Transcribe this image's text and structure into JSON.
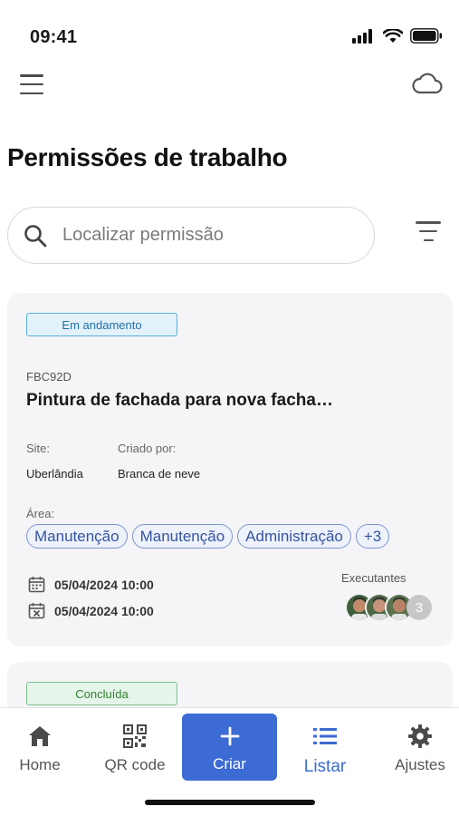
{
  "status_bar": {
    "time": "09:41"
  },
  "header": {
    "title": "Permissões de trabalho"
  },
  "search": {
    "placeholder": "Localizar permissão"
  },
  "permits": [
    {
      "status": "Em andamento",
      "code": "FBC92D",
      "title": "Pintura de fachada para nova facha…",
      "site_label": "Site:",
      "site_value": "Uberlândia",
      "creator_label": "Criado por:",
      "creator_value": "Branca de neve",
      "area_label": "Área:",
      "areas": [
        "Manutenção",
        "Manutenção",
        "Administração",
        "+3"
      ],
      "start_date": "05/04/2024 10:00",
      "end_date": "05/04/2024 10:00",
      "executors_label": "Executantes",
      "executors_more": "3"
    },
    {
      "status": "Concluída"
    }
  ],
  "bottom_nav": {
    "home": "Home",
    "qr": "QR code",
    "create": "Criar",
    "list": "Listar",
    "settings": "Ajustes"
  },
  "colors": {
    "accent": "#3c6bd4",
    "status_in_progress": "#5aaee0",
    "status_done": "#7cc08b",
    "tag_border": "#7e97cf"
  },
  "icons": [
    "signal-icon",
    "wifi-icon",
    "battery-icon",
    "menu-icon",
    "cloud-icon",
    "search-icon",
    "filter-icon",
    "calendar-start-icon",
    "calendar-end-icon",
    "home-icon",
    "qr-code-icon",
    "plus-icon",
    "list-icon",
    "gear-icon"
  ]
}
